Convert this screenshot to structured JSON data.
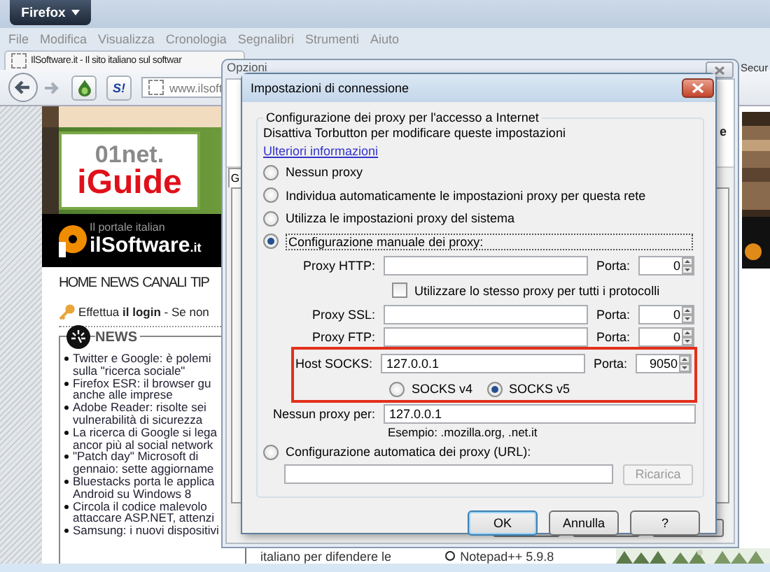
{
  "browser": {
    "app_button": "Firefox",
    "menu": [
      "File",
      "Modifica",
      "Visualizza",
      "Cronologia",
      "Segnalibri",
      "Strumenti",
      "Aiuto"
    ],
    "tab_title": "IlSoftware.it - Il sito italiano sul softwar",
    "toolbar_logo": "S!",
    "url": "www.ilsoft",
    "side_tab": "Secur"
  },
  "page": {
    "logo_brand": "01net.",
    "logo_product": "iGuide",
    "banner_tagline": "Il portale italian",
    "banner_site": "ilSoftware",
    "banner_suffix": ".it",
    "nav": [
      "HOME",
      "NEWS",
      "CANALI",
      "TIP"
    ],
    "login": "Effettua **il login** - Se non",
    "news_title": "NEWS",
    "news": [
      {
        "lines": [
          "Twitter e Google: è polemi",
          "sulla \"ricerca sociale\""
        ]
      },
      {
        "lines": [
          "Firefox ESR: il browser gu",
          "anche alle imprese"
        ]
      },
      {
        "lines": [
          "Adobe Reader: risolte sei",
          "vulnerabilità di sicurezza"
        ]
      },
      {
        "lines": [
          "La ricerca di Google si lega",
          "ancor più al social network"
        ]
      },
      {
        "lines": [
          "\"Patch day\" Microsoft di",
          "gennaio: sette aggiorname"
        ]
      },
      {
        "lines": [
          "Bluestacks porta le applica",
          "Android su Windows 8"
        ]
      },
      {
        "lines": [
          "Circola il codice malevolo",
          "attaccare ASP.NET, attenzi"
        ]
      },
      {
        "lines": [
          "Samsung: i nuovi dispositivi"
        ]
      }
    ],
    "bottom_text": "italiano per difendere le",
    "bottom_link": "Notepad++ 5.9.8"
  },
  "options_window": {
    "title": "Opzioni",
    "tab": "G",
    "fragment": "e"
  },
  "dialog": {
    "title": "Impostazioni di connessione",
    "group_title": "Configurazione dei proxy per l'accesso a Internet",
    "notice": "Disattiva Torbutton per modificare queste impostazioni",
    "link": "Ulteriori informazioni",
    "modes": [
      {
        "kind": "simple",
        "label": "Nessun proxy",
        "selected": false
      },
      {
        "kind": "simple",
        "label": "Individua automaticamente le impostazioni proxy per questa rete",
        "selected": false
      },
      {
        "kind": "simple",
        "label": "Utilizza le impostazioni proxy del sistema",
        "selected": false
      },
      {
        "kind": "manual",
        "label": "Configurazione manuale dei proxy:",
        "selected": true
      },
      {
        "kind": "auto",
        "label": "Configurazione automatica dei proxy (URL):",
        "selected": false
      }
    ],
    "manual": {
      "rows": [
        {
          "kind": "proxy",
          "label": "Proxy HTTP:",
          "port_label": "Porta:",
          "port": "0"
        },
        {
          "kind": "checkbox",
          "label": "Utilizzare lo stesso proxy per tutti i protocolli",
          "checked": false
        },
        {
          "kind": "proxy",
          "label": "Proxy SSL:",
          "port_label": "Porta:",
          "port": "0"
        },
        {
          "kind": "proxy",
          "label": "Proxy FTP:",
          "port_label": "Porta:",
          "port": "0"
        }
      ],
      "socks": {
        "label": "Host SOCKS:",
        "value": "127.0.0.1",
        "port_label": "Porta:",
        "port": "9050",
        "highlighted": true,
        "versions": [
          {
            "label": "SOCKS v4",
            "selected": false
          },
          {
            "label": "SOCKS v5",
            "selected": true
          }
        ]
      },
      "no_proxy": {
        "label": "Nessun proxy per:",
        "value": "127.0.0.1",
        "example": "Esempio: .mozilla.org, .net.it"
      }
    },
    "auto": {
      "reload_button": {
        "label": "Ricarica",
        "disabled": true
      }
    },
    "buttons": [
      {
        "label": "OK",
        "default": true
      },
      {
        "label": "Annulla",
        "default": false
      },
      {
        "label": "?",
        "default": false
      }
    ]
  }
}
